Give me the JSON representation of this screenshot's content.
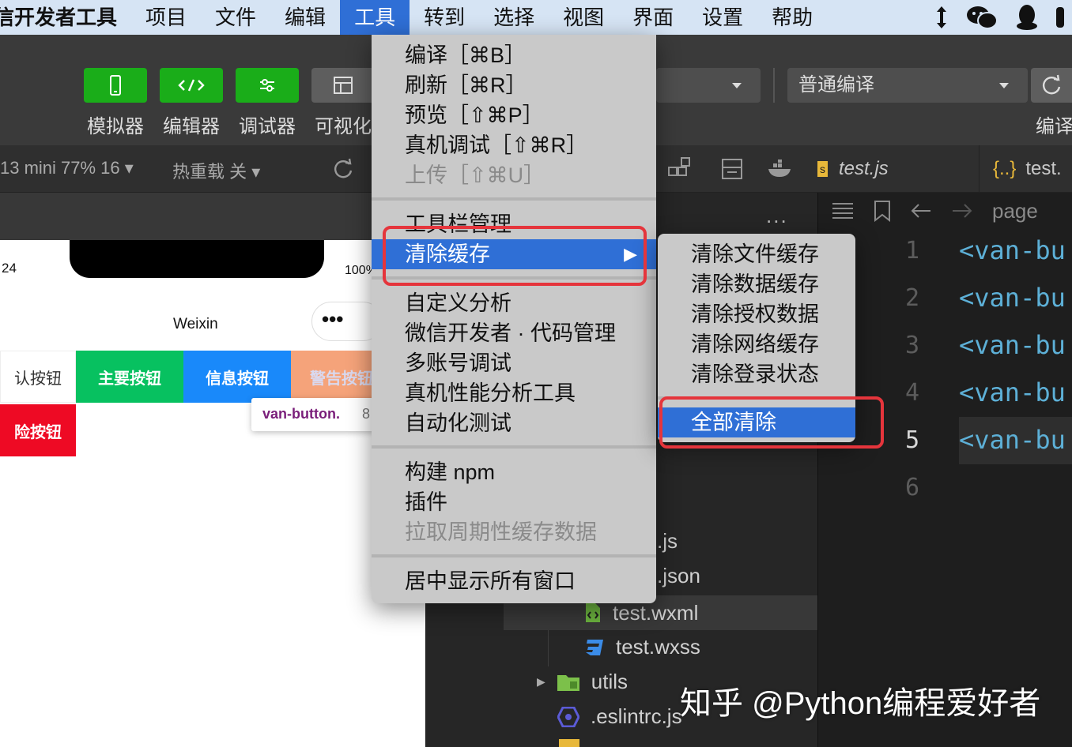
{
  "menubar": {
    "app": "信开发者工具",
    "items": [
      "项目",
      "文件",
      "编辑",
      "工具",
      "转到",
      "选择",
      "视图",
      "界面",
      "设置",
      "帮助"
    ],
    "active_index": 3
  },
  "toolbar": {
    "buttons": [
      "模拟器",
      "编辑器",
      "调试器",
      "可视化"
    ],
    "compile_mode": "普通编译",
    "compile_label": "编译"
  },
  "subbar": {
    "device": "13 mini 77% 16",
    "hot_reload": "热重载 关",
    "tab1": "test.js",
    "tab1_badge": "s",
    "tab2": "test.",
    "tab2_icon": "{..}"
  },
  "simulator": {
    "time": "24",
    "battery": "100%",
    "nav_title": "Weixin",
    "capsule": "•••",
    "buttons": [
      "认按钮",
      "主要按钮",
      "信息按钮",
      "警告按钮",
      "险按钮"
    ],
    "tooltip_name": "van-button.",
    "tooltip_size": "8"
  },
  "explorer": {
    "dots": "...",
    "files": [
      ".js",
      ".json",
      "test.wxml",
      "test.wxss",
      "utils",
      ".eslintrc.js"
    ]
  },
  "editor": {
    "breadcrumb": "page",
    "line_numbers": [
      "1",
      "2",
      "3",
      "4",
      "5",
      "6"
    ],
    "code": [
      "<van-bu",
      "<van-bu",
      "<van-bu",
      "<van-bu",
      "<van-bu"
    ],
    "current_line": 5
  },
  "tools_menu": {
    "items": [
      {
        "label": "编译［⌘B］",
        "disabled": false
      },
      {
        "label": "刷新［⌘R］",
        "disabled": false
      },
      {
        "label": "预览［⇧⌘P］",
        "disabled": false
      },
      {
        "label": "真机调试［⇧⌘R］",
        "disabled": false
      },
      {
        "label": "上传［⇧⌘U］",
        "disabled": true
      },
      {
        "label": "工具栏管理",
        "disabled": false
      },
      {
        "label": "清除缓存",
        "disabled": false
      },
      {
        "label": "自定义分析",
        "disabled": false
      },
      {
        "label": "微信开发者 · 代码管理",
        "disabled": false
      },
      {
        "label": "多账号调试",
        "disabled": false
      },
      {
        "label": "真机性能分析工具",
        "disabled": false
      },
      {
        "label": "自动化测试",
        "disabled": false
      },
      {
        "label": "构建 npm",
        "disabled": false
      },
      {
        "label": "插件",
        "disabled": false
      },
      {
        "label": "拉取周期性缓存数据",
        "disabled": true
      },
      {
        "label": "居中显示所有窗口",
        "disabled": false
      }
    ],
    "highlighted_index": 6,
    "submenu_arrow": "▶"
  },
  "clear_cache_submenu": {
    "items": [
      "清除文件缓存",
      "清除数据缓存",
      "清除授权数据",
      "清除网络缓存",
      "清除登录状态",
      "全部清除"
    ],
    "highlighted_index": 5
  },
  "watermark": "知乎 @Python编程爱好者",
  "colors": {
    "menu_highlight": "#2f6fd6",
    "annotation_red": "#e5353c",
    "wechat_green": "#1aad19"
  }
}
